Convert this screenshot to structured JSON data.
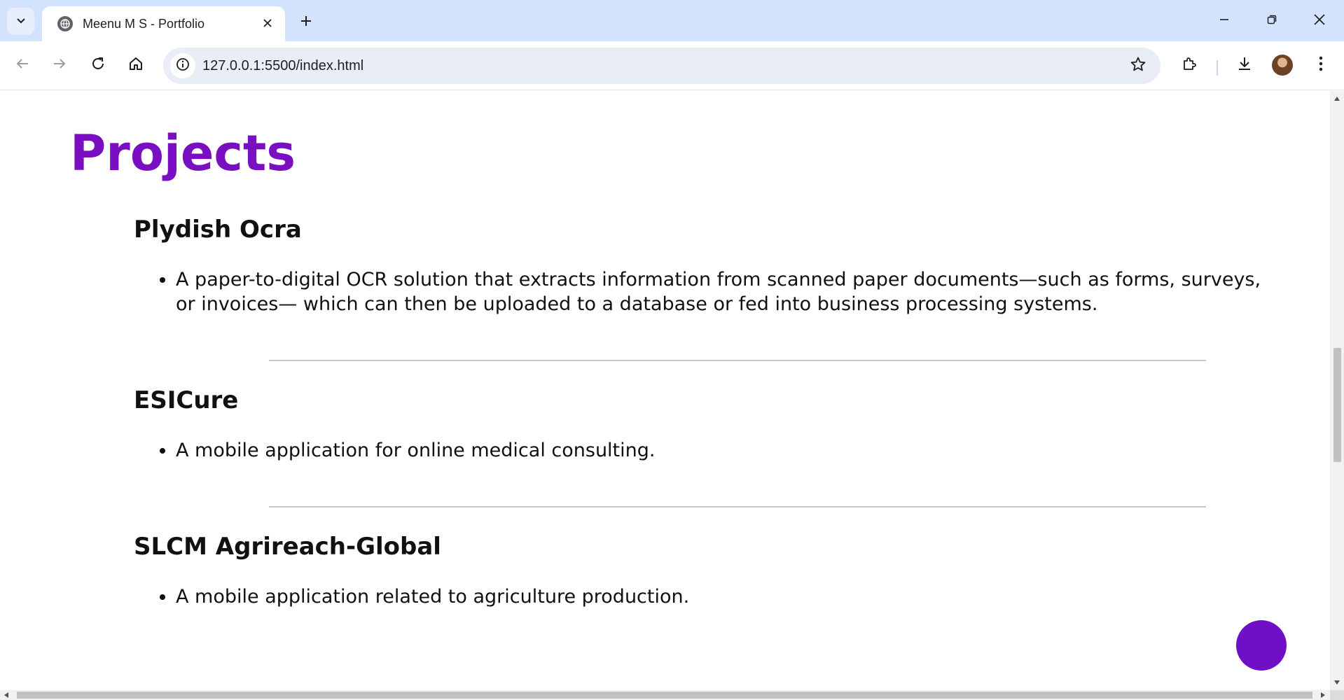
{
  "browser": {
    "tab_title": "Meenu M S - Portfolio",
    "url": "127.0.0.1:5500/index.html"
  },
  "icons": [
    "tab-search-icon",
    "globe-icon",
    "close-icon",
    "plus-icon",
    "minimize-icon",
    "restore-icon",
    "window-close-icon",
    "back-icon",
    "forward-icon",
    "reload-icon",
    "home-icon",
    "site-info-icon",
    "star-icon",
    "extensions-icon",
    "download-icon",
    "avatar",
    "menu-icon"
  ],
  "page": {
    "heading": "Projects",
    "projects": [
      {
        "title": "Plydish Ocra",
        "description": "A paper-to-digital OCR solution that extracts information from scanned paper documents—such as forms, surveys, or invoices— which can then be uploaded to a database or fed into business processing systems."
      },
      {
        "title": "ESICure",
        "description": "A mobile application for online medical consulting."
      },
      {
        "title": "SLCM Agrireach-Global",
        "description": "A mobile application related to agriculture production."
      }
    ]
  },
  "colors": {
    "accent": "#7a0fc2",
    "fab": "#6f0fc6",
    "tabstrip": "#d3e3fd",
    "omnibox": "#e9eef6"
  },
  "scroll": {
    "vertical_position": 0.43,
    "vertical_visible_fraction": 0.19,
    "horizontal_visible_fraction": 0.98
  }
}
